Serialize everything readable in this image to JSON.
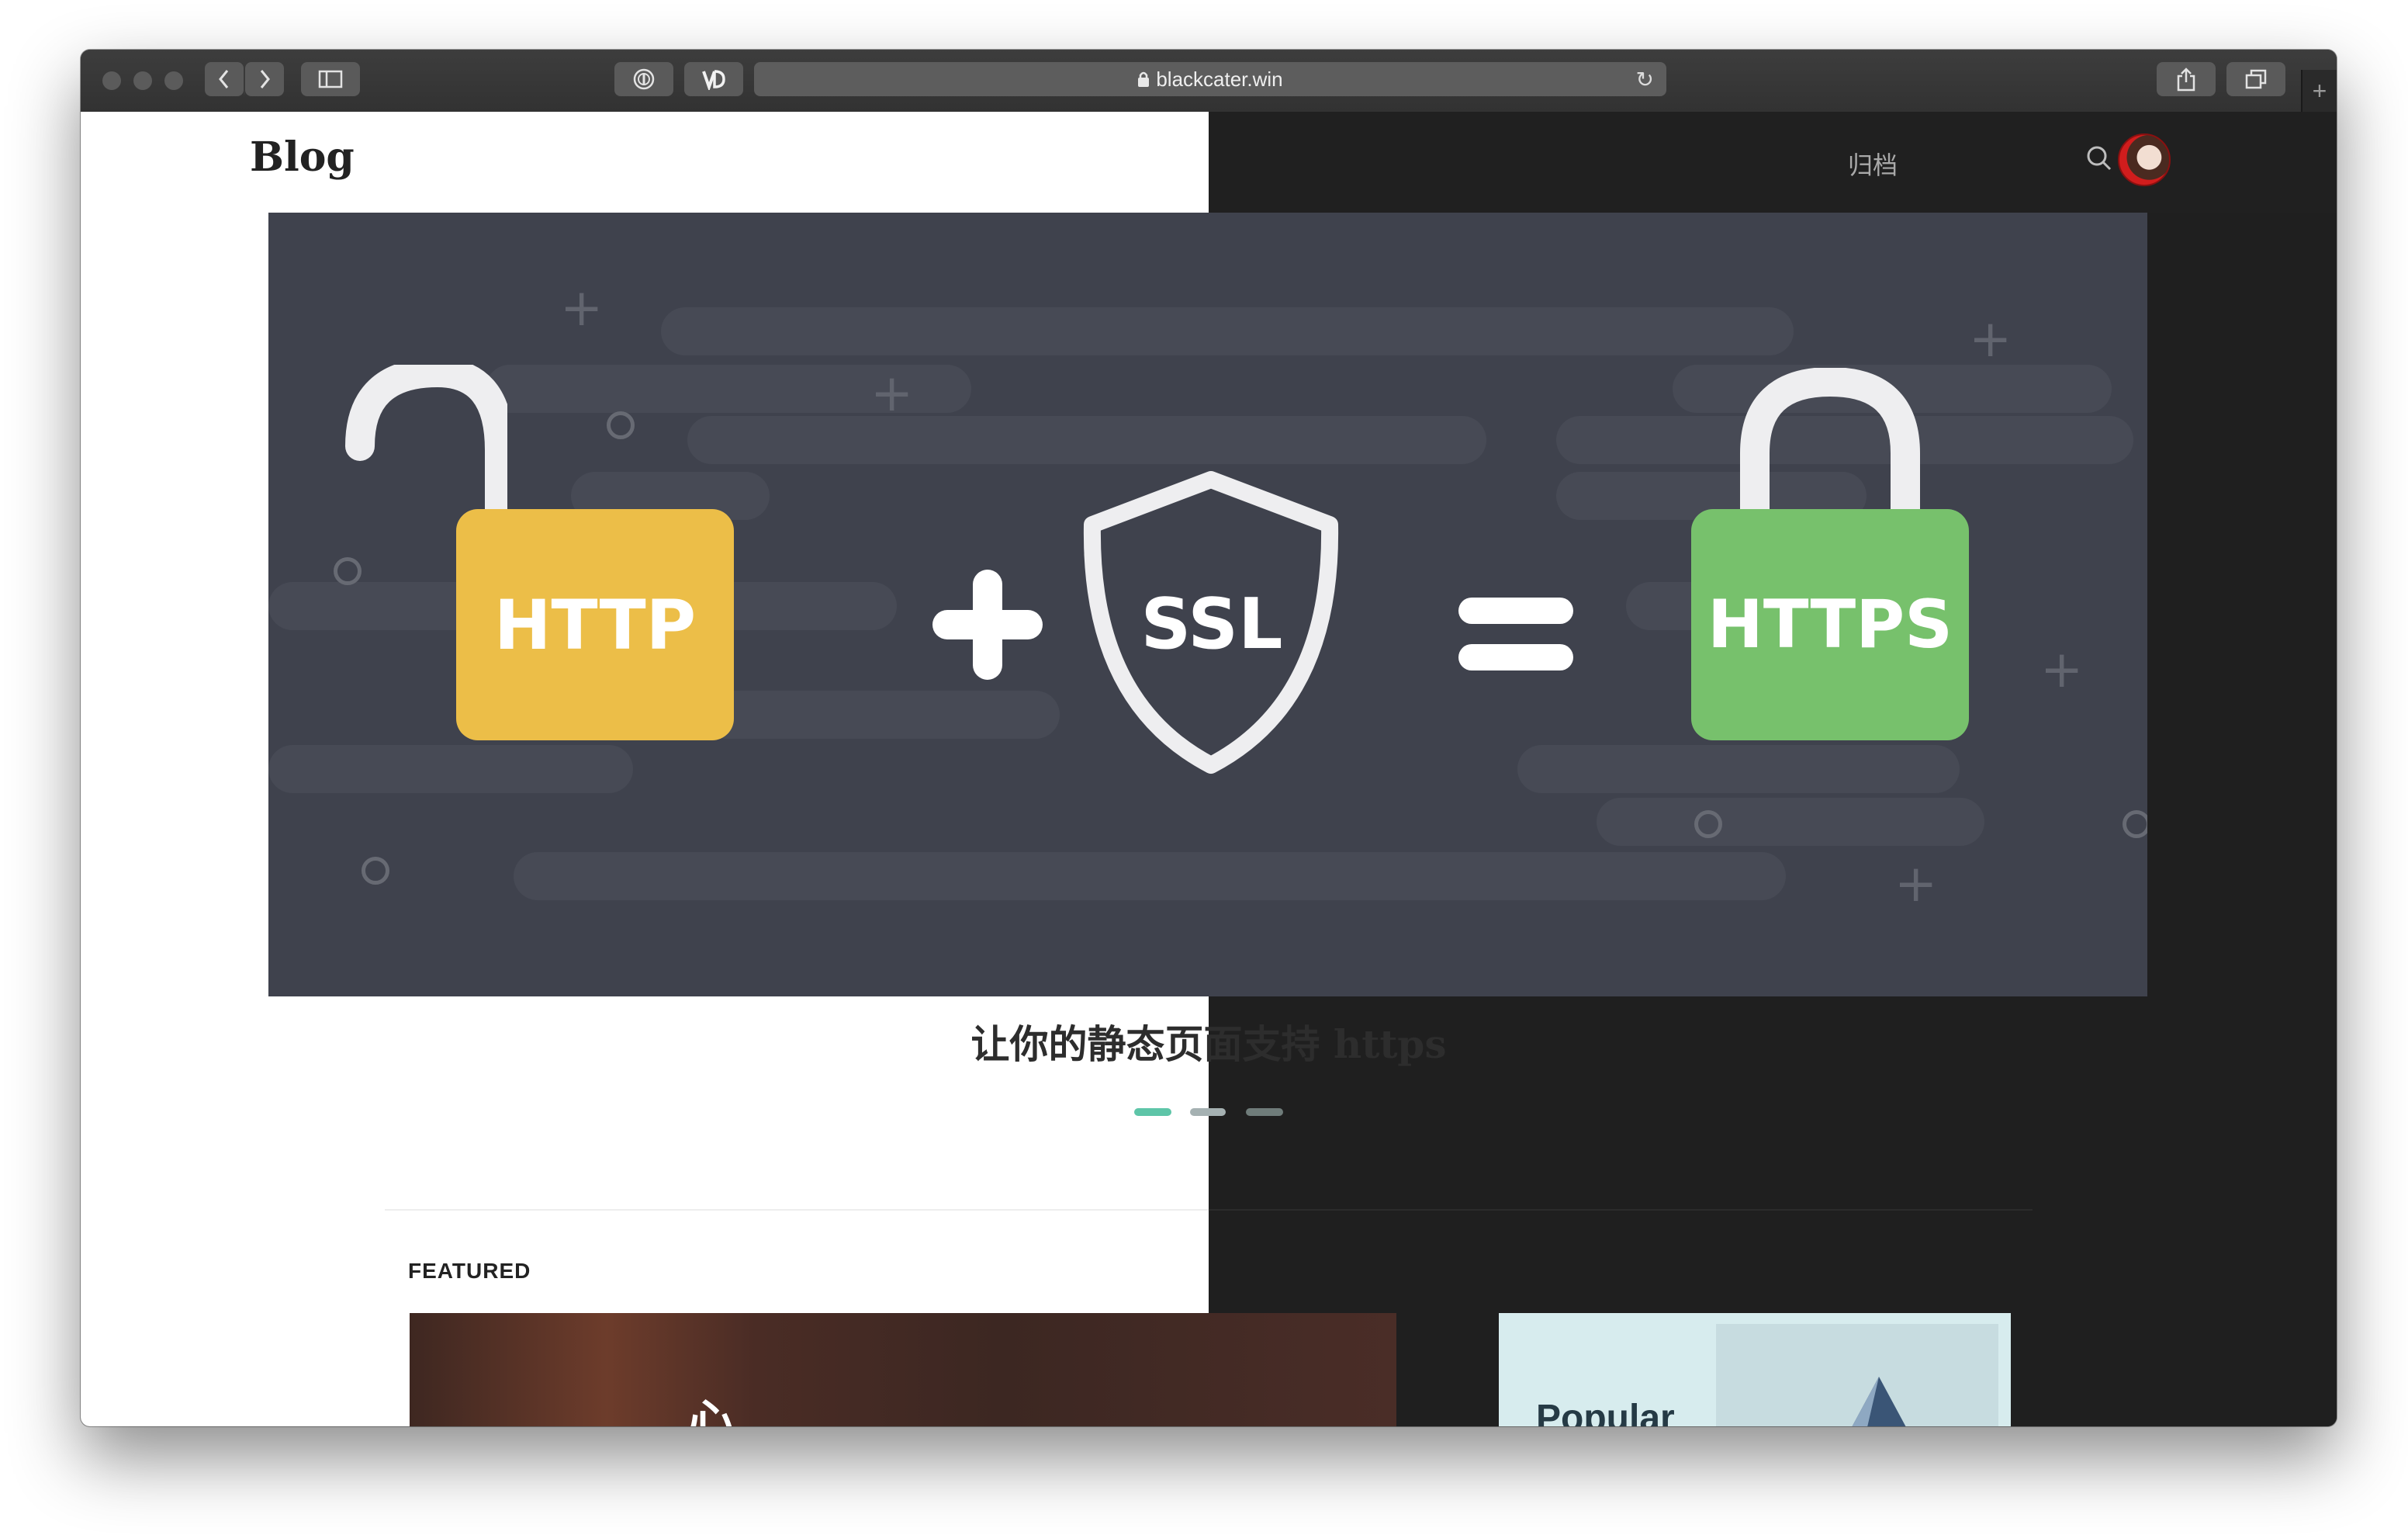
{
  "browser": {
    "url": "blackcater.win"
  },
  "site": {
    "logo": "Blog",
    "nav": {
      "archive_label": "归档"
    }
  },
  "hero": {
    "labels": {
      "http": "HTTP",
      "ssl": "SSL",
      "https": "HTTPS"
    },
    "caption": "让你的静态页面支持 https",
    "carousel": {
      "count": 3,
      "active_index": 0
    }
  },
  "featured": {
    "section_label": "FEATURED",
    "cards": [
      {
        "title_partial": "心"
      },
      {
        "title_partial": "Popular"
      }
    ]
  },
  "colors": {
    "http_yellow": "#ecbe48",
    "https_green": "#77c16c",
    "hero_bg": "#3f424d",
    "accent_teal": "#5ec5a8"
  }
}
